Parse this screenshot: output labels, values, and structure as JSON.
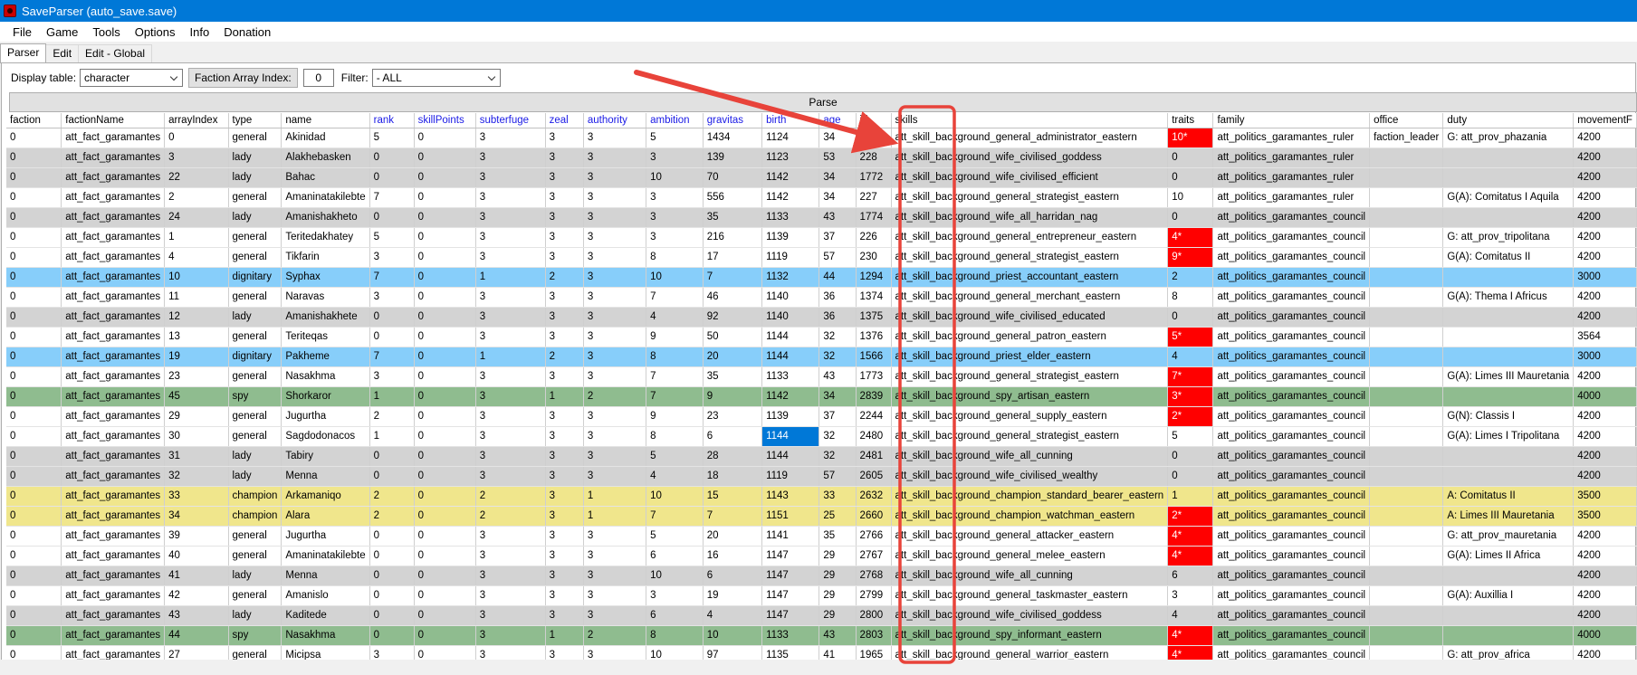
{
  "window": {
    "title": "SaveParser (auto_save.save)"
  },
  "menu": [
    "File",
    "Game",
    "Tools",
    "Options",
    "Info",
    "Donation"
  ],
  "tabs": [
    "Parser",
    "Edit",
    "Edit - Global"
  ],
  "controls": {
    "display_table_label": "Display table:",
    "display_table_value": "character",
    "faction_array_label": "Faction Array Index:",
    "faction_array_value": "0",
    "filter_label": "Filter:",
    "filter_value": "- ALL",
    "parse_label": "Parse"
  },
  "colors": {
    "lady": "#d3d3d3",
    "dignitary": "#87cefa",
    "spy": "#8fbc8f",
    "champion": "#f0e68c",
    "flag": "#ff0000",
    "annotation": "#e8433a"
  },
  "columns": [
    "faction",
    "factionName",
    "arrayIndex",
    "type",
    "name",
    "rank",
    "skillPoints",
    "subterfuge",
    "zeal",
    "authority",
    "ambition",
    "gravitas",
    "birth",
    "age",
    "id",
    "skills",
    "traits",
    "family",
    "office",
    "duty",
    "movementF"
  ],
  "rows": [
    [
      "0",
      "att_fact_garamantes",
      "0",
      "general",
      "Akinidad",
      "5",
      "0",
      "3",
      "3",
      "3",
      "5",
      "1434",
      "1124",
      "34",
      "223",
      "att_skill_background_general_administrator_eastern",
      "10*",
      "att_politics_garamantes_ruler",
      "faction_leader",
      "G: att_prov_phazania",
      "4200"
    ],
    [
      "0",
      "att_fact_garamantes",
      "3",
      "lady",
      "Alakhebasken",
      "0",
      "0",
      "3",
      "3",
      "3",
      "3",
      "139",
      "1123",
      "53",
      "228",
      "att_skill_background_wife_civilised_goddess",
      "0",
      "att_politics_garamantes_ruler",
      "",
      "",
      "4200"
    ],
    [
      "0",
      "att_fact_garamantes",
      "22",
      "lady",
      "Bahac",
      "0",
      "0",
      "3",
      "3",
      "3",
      "10",
      "70",
      "1142",
      "34",
      "1772",
      "att_skill_background_wife_civilised_efficient",
      "0",
      "att_politics_garamantes_ruler",
      "",
      "",
      "4200"
    ],
    [
      "0",
      "att_fact_garamantes",
      "2",
      "general",
      "Amaninatakilebte",
      "7",
      "0",
      "3",
      "3",
      "3",
      "3",
      "556",
      "1142",
      "34",
      "227",
      "att_skill_background_general_strategist_eastern",
      "10",
      "att_politics_garamantes_ruler",
      "",
      "G(A): Comitatus I Aquila",
      "4200"
    ],
    [
      "0",
      "att_fact_garamantes",
      "24",
      "lady",
      "Amanishakheto",
      "0",
      "0",
      "3",
      "3",
      "3",
      "3",
      "35",
      "1133",
      "43",
      "1774",
      "att_skill_background_wife_all_harridan_nag",
      "0",
      "att_politics_garamantes_council",
      "",
      "",
      "4200"
    ],
    [
      "0",
      "att_fact_garamantes",
      "1",
      "general",
      "Teritedakhatey",
      "5",
      "0",
      "3",
      "3",
      "3",
      "3",
      "216",
      "1139",
      "37",
      "226",
      "att_skill_background_general_entrepreneur_eastern",
      "4*",
      "att_politics_garamantes_council",
      "",
      "G: att_prov_tripolitana",
      "4200"
    ],
    [
      "0",
      "att_fact_garamantes",
      "4",
      "general",
      "Tikfarin",
      "3",
      "0",
      "3",
      "3",
      "3",
      "8",
      "17",
      "1119",
      "57",
      "230",
      "att_skill_background_general_strategist_eastern",
      "9*",
      "att_politics_garamantes_council",
      "",
      "G(A): Comitatus II",
      "4200"
    ],
    [
      "0",
      "att_fact_garamantes",
      "10",
      "dignitary",
      "Syphax",
      "7",
      "0",
      "1",
      "2",
      "3",
      "10",
      "7",
      "1132",
      "44",
      "1294",
      "att_skill_background_priest_accountant_eastern",
      "2",
      "att_politics_garamantes_council",
      "",
      "",
      "3000"
    ],
    [
      "0",
      "att_fact_garamantes",
      "11",
      "general",
      "Naravas",
      "3",
      "0",
      "3",
      "3",
      "3",
      "7",
      "46",
      "1140",
      "36",
      "1374",
      "att_skill_background_general_merchant_eastern",
      "8",
      "att_politics_garamantes_council",
      "",
      "G(A): Thema I Africus",
      "4200"
    ],
    [
      "0",
      "att_fact_garamantes",
      "12",
      "lady",
      "Amanishakhete",
      "0",
      "0",
      "3",
      "3",
      "3",
      "4",
      "92",
      "1140",
      "36",
      "1375",
      "att_skill_background_wife_civilised_educated",
      "0",
      "att_politics_garamantes_council",
      "",
      "",
      "4200"
    ],
    [
      "0",
      "att_fact_garamantes",
      "13",
      "general",
      "Teriteqas",
      "0",
      "0",
      "3",
      "3",
      "3",
      "9",
      "50",
      "1144",
      "32",
      "1376",
      "att_skill_background_general_patron_eastern",
      "5*",
      "att_politics_garamantes_council",
      "",
      "",
      "3564"
    ],
    [
      "0",
      "att_fact_garamantes",
      "19",
      "dignitary",
      "Pakheme",
      "7",
      "0",
      "1",
      "2",
      "3",
      "8",
      "20",
      "1144",
      "32",
      "1566",
      "att_skill_background_priest_elder_eastern",
      "4",
      "att_politics_garamantes_council",
      "",
      "",
      "3000"
    ],
    [
      "0",
      "att_fact_garamantes",
      "23",
      "general",
      "Nasakhma",
      "3",
      "0",
      "3",
      "3",
      "3",
      "7",
      "35",
      "1133",
      "43",
      "1773",
      "att_skill_background_general_strategist_eastern",
      "7*",
      "att_politics_garamantes_council",
      "",
      "G(A): Limes III Mauretania",
      "4200"
    ],
    [
      "0",
      "att_fact_garamantes",
      "45",
      "spy",
      "Shorkaror",
      "1",
      "0",
      "3",
      "1",
      "2",
      "7",
      "9",
      "1142",
      "34",
      "2839",
      "att_skill_background_spy_artisan_eastern",
      "3*",
      "att_politics_garamantes_council",
      "",
      "",
      "4000"
    ],
    [
      "0",
      "att_fact_garamantes",
      "29",
      "general",
      "Jugurtha",
      "2",
      "0",
      "3",
      "3",
      "3",
      "9",
      "23",
      "1139",
      "37",
      "2244",
      "att_skill_background_general_supply_eastern",
      "2*",
      "att_politics_garamantes_council",
      "",
      "G(N): Classis I",
      "4200"
    ],
    [
      "0",
      "att_fact_garamantes",
      "30",
      "general",
      "Sagdodonacos",
      "1",
      "0",
      "3",
      "3",
      "3",
      "8",
      "6",
      "1144",
      "32",
      "2480",
      "att_skill_background_general_strategist_eastern",
      "5",
      "att_politics_garamantes_council",
      "",
      "G(A): Limes I Tripolitana",
      "4200"
    ],
    [
      "0",
      "att_fact_garamantes",
      "31",
      "lady",
      "Tabiry",
      "0",
      "0",
      "3",
      "3",
      "3",
      "5",
      "28",
      "1144",
      "32",
      "2481",
      "att_skill_background_wife_all_cunning",
      "0",
      "att_politics_garamantes_council",
      "",
      "",
      "4200"
    ],
    [
      "0",
      "att_fact_garamantes",
      "32",
      "lady",
      "Menna",
      "0",
      "0",
      "3",
      "3",
      "3",
      "4",
      "18",
      "1119",
      "57",
      "2605",
      "att_skill_background_wife_civilised_wealthy",
      "0",
      "att_politics_garamantes_council",
      "",
      "",
      "4200"
    ],
    [
      "0",
      "att_fact_garamantes",
      "33",
      "champion",
      "Arkamaniqo",
      "2",
      "0",
      "2",
      "3",
      "1",
      "10",
      "15",
      "1143",
      "33",
      "2632",
      "att_skill_background_champion_standard_bearer_eastern",
      "1",
      "att_politics_garamantes_council",
      "",
      "A: Comitatus II",
      "3500"
    ],
    [
      "0",
      "att_fact_garamantes",
      "34",
      "champion",
      "Alara",
      "2",
      "0",
      "2",
      "3",
      "1",
      "7",
      "7",
      "1151",
      "25",
      "2660",
      "att_skill_background_champion_watchman_eastern",
      "2*",
      "att_politics_garamantes_council",
      "",
      "A: Limes III Mauretania",
      "3500"
    ],
    [
      "0",
      "att_fact_garamantes",
      "39",
      "general",
      "Jugurtha",
      "0",
      "0",
      "3",
      "3",
      "3",
      "5",
      "20",
      "1141",
      "35",
      "2766",
      "att_skill_background_general_attacker_eastern",
      "4*",
      "att_politics_garamantes_council",
      "",
      "G: att_prov_mauretania",
      "4200"
    ],
    [
      "0",
      "att_fact_garamantes",
      "40",
      "general",
      "Amaninatakilebte",
      "0",
      "0",
      "3",
      "3",
      "3",
      "6",
      "16",
      "1147",
      "29",
      "2767",
      "att_skill_background_general_melee_eastern",
      "4*",
      "att_politics_garamantes_council",
      "",
      "G(A): Limes II Africa",
      "4200"
    ],
    [
      "0",
      "att_fact_garamantes",
      "41",
      "lady",
      "Menna",
      "0",
      "0",
      "3",
      "3",
      "3",
      "10",
      "6",
      "1147",
      "29",
      "2768",
      "att_skill_background_wife_all_cunning",
      "6",
      "att_politics_garamantes_council",
      "",
      "",
      "4200"
    ],
    [
      "0",
      "att_fact_garamantes",
      "42",
      "general",
      "Amanislo",
      "0",
      "0",
      "3",
      "3",
      "3",
      "3",
      "19",
      "1147",
      "29",
      "2799",
      "att_skill_background_general_taskmaster_eastern",
      "3",
      "att_politics_garamantes_council",
      "",
      "G(A): Auxillia I",
      "4200"
    ],
    [
      "0",
      "att_fact_garamantes",
      "43",
      "lady",
      "Kaditede",
      "0",
      "0",
      "3",
      "3",
      "3",
      "6",
      "4",
      "1147",
      "29",
      "2800",
      "att_skill_background_wife_civilised_goddess",
      "4",
      "att_politics_garamantes_council",
      "",
      "",
      "4200"
    ],
    [
      "0",
      "att_fact_garamantes",
      "44",
      "spy",
      "Nasakhma",
      "0",
      "0",
      "3",
      "1",
      "2",
      "8",
      "10",
      "1133",
      "43",
      "2803",
      "att_skill_background_spy_informant_eastern",
      "4*",
      "att_politics_garamantes_council",
      "",
      "",
      "4000"
    ],
    [
      "0",
      "att_fact_garamantes",
      "27",
      "general",
      "Micipsa",
      "3",
      "0",
      "3",
      "3",
      "3",
      "10",
      "97",
      "1135",
      "41",
      "1965",
      "att_skill_background_general_warrior_eastern",
      "4*",
      "att_politics_garamantes_council",
      "",
      "G: att_prov_africa",
      "4200"
    ]
  ]
}
